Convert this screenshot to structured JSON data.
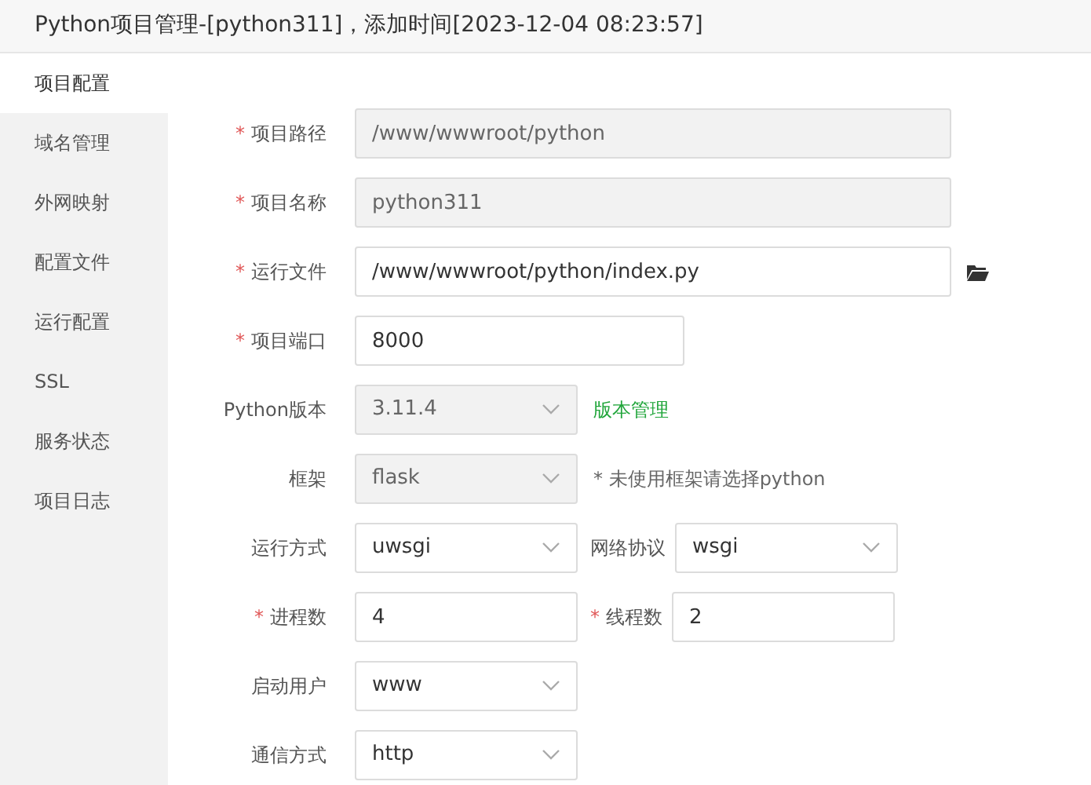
{
  "window": {
    "title": "Python项目管理-[python311]，添加时间[2023-12-04 08:23:57]"
  },
  "sidebar": {
    "items": [
      {
        "label": "项目配置",
        "selected": true
      },
      {
        "label": "域名管理",
        "selected": false
      },
      {
        "label": "外网映射",
        "selected": false
      },
      {
        "label": "配置文件",
        "selected": false
      },
      {
        "label": "运行配置",
        "selected": false
      },
      {
        "label": "SSL",
        "selected": false
      },
      {
        "label": "服务状态",
        "selected": false
      },
      {
        "label": "项目日志",
        "selected": false
      }
    ]
  },
  "form": {
    "rows": [
      {
        "fields": [
          {
            "mark": "*",
            "label": "项目路径",
            "kind": "text",
            "value": "/www/wwwroot/python",
            "disabled": true
          }
        ]
      },
      {
        "fields": [
          {
            "mark": "*",
            "label": "项目名称",
            "kind": "text",
            "value": "python311",
            "disabled": true
          }
        ]
      },
      {
        "fields": [
          {
            "mark": "*",
            "label": "运行文件",
            "kind": "text",
            "value": "/www/wwwroot/python/index.py",
            "disabled": false
          }
        ],
        "extra": {
          "kind": "browse"
        }
      },
      {
        "fields": [
          {
            "mark": "*",
            "label": "项目端口",
            "kind": "text",
            "value": "8000",
            "disabled": false
          }
        ]
      },
      {
        "fields": [
          {
            "label": "Python版本",
            "kind": "select",
            "value": "3.11.4",
            "disabled": true
          }
        ],
        "extra": {
          "kind": "link",
          "text": "版本管理"
        }
      },
      {
        "fields": [
          {
            "label": "框架",
            "kind": "select",
            "value": "flask",
            "disabled": true
          }
        ],
        "extra": {
          "kind": "note",
          "text": "* 未使用框架请选择python"
        }
      },
      {
        "fields": [
          {
            "label": "运行方式",
            "kind": "select",
            "value": "uwsgi",
            "disabled": false
          },
          {
            "label": "网络协议",
            "kind": "select",
            "value": "wsgi",
            "disabled": false
          }
        ]
      },
      {
        "fields": [
          {
            "mark": "*",
            "label": "进程数",
            "kind": "text",
            "value": "4",
            "disabled": false
          },
          {
            "mark": "*",
            "label": "线程数",
            "kind": "text",
            "value": "2",
            "disabled": false
          }
        ]
      },
      {
        "fields": [
          {
            "label": "启动用户",
            "kind": "select",
            "value": "www",
            "disabled": false
          }
        ]
      },
      {
        "fields": [
          {
            "label": "通信方式",
            "kind": "select",
            "value": "http",
            "disabled": false
          }
        ]
      }
    ]
  }
}
